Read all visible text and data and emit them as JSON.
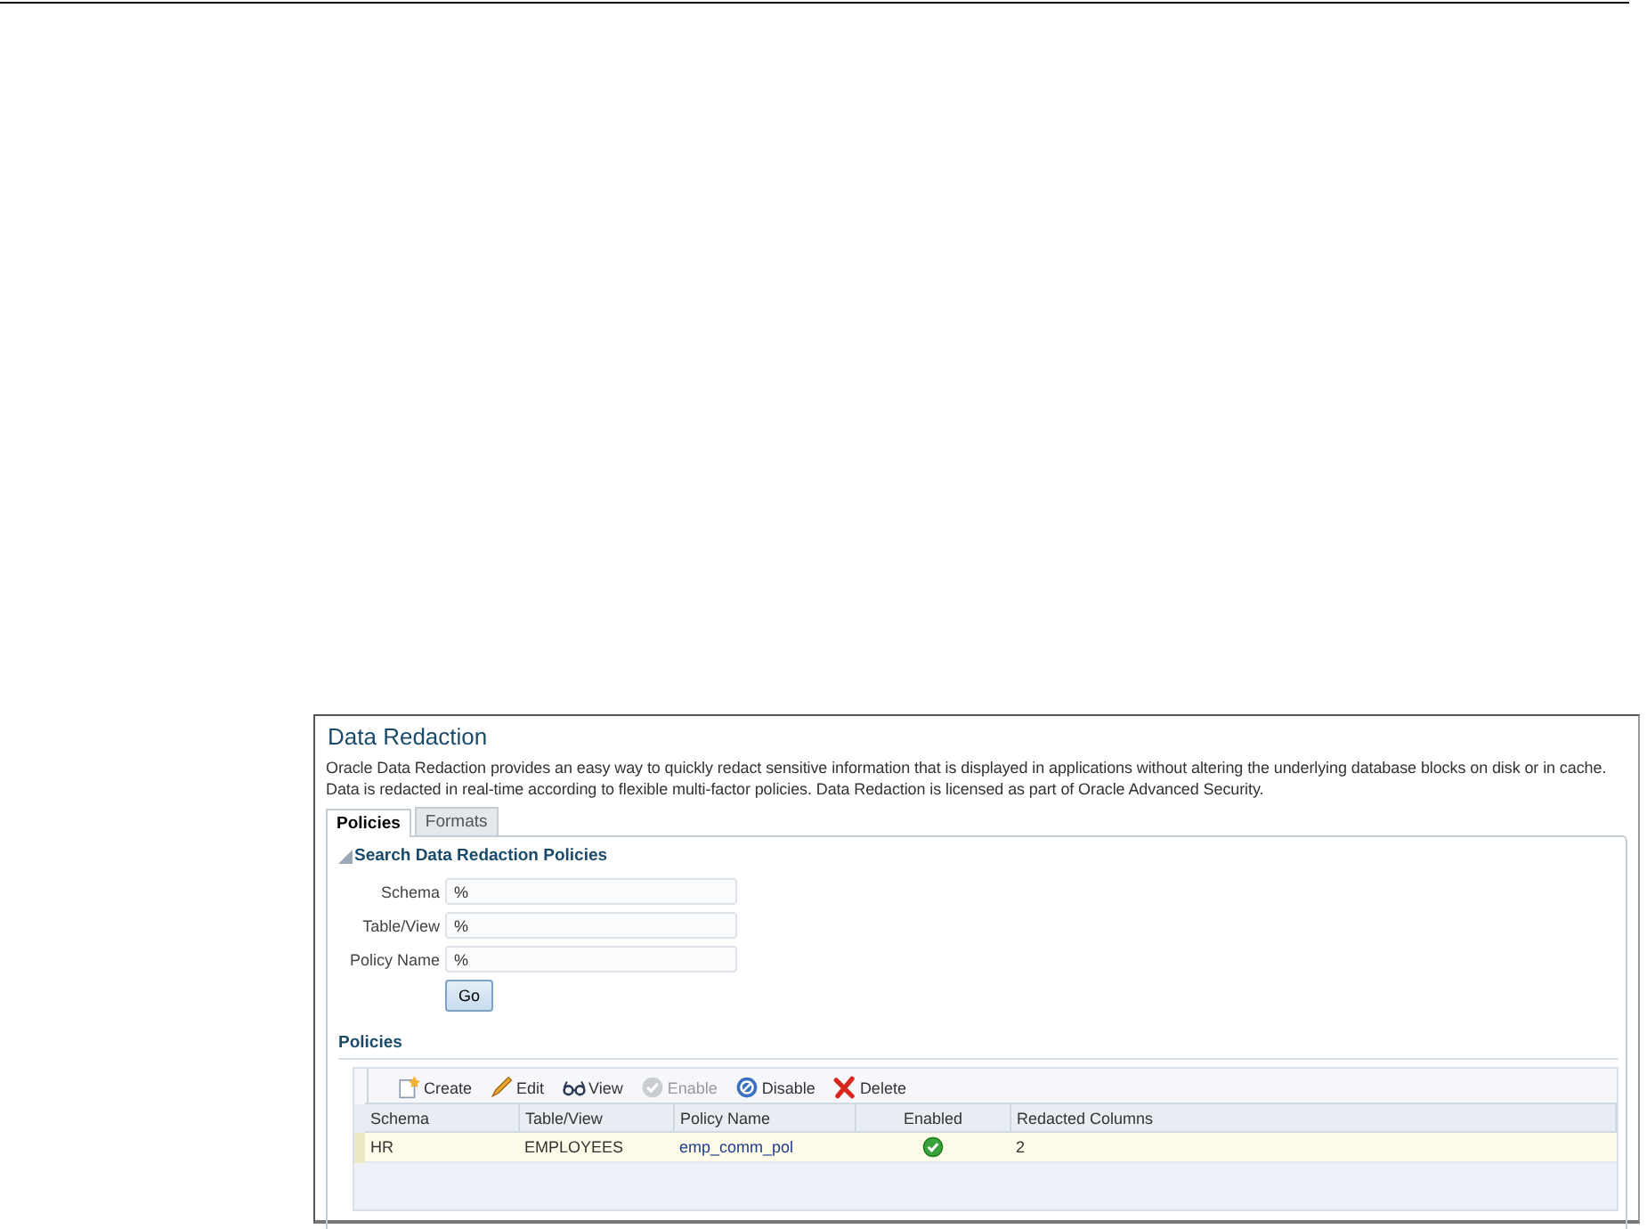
{
  "title": "Data Redaction",
  "description": [
    "Oracle Data Redaction provides an easy way to quickly redact sensitive information that is displayed in applications without altering the underlying database blocks on disk or in cache.",
    "Data is redacted in real-time according to flexible multi-factor policies. Data Redaction is licensed as part of Oracle Advanced Security."
  ],
  "tabs": [
    {
      "label": "Policies",
      "selected": true
    },
    {
      "label": "Formats",
      "selected": false
    }
  ],
  "search": {
    "title": "Search Data Redaction Policies",
    "expanded": true,
    "fields": [
      {
        "label": "Schema",
        "value": "%"
      },
      {
        "label": "Table/View",
        "value": "%"
      },
      {
        "label": "Policy Name",
        "value": "%"
      }
    ],
    "button": "Go"
  },
  "policies": {
    "title": "Policies",
    "toolbar": [
      {
        "kind": "create",
        "label": "Create",
        "disabled": false
      },
      {
        "kind": "edit",
        "label": "Edit",
        "disabled": false
      },
      {
        "kind": "view",
        "label": "View",
        "disabled": false
      },
      {
        "kind": "enable",
        "label": "Enable",
        "disabled": true
      },
      {
        "kind": "disable",
        "label": "Disable",
        "disabled": false
      },
      {
        "kind": "delete",
        "label": "Delete",
        "disabled": false
      }
    ],
    "columns": [
      "Schema",
      "Table/View",
      "Policy Name",
      "Enabled",
      "Redacted Columns"
    ],
    "rows": [
      {
        "schema": "HR",
        "table": "EMPLOYEES",
        "policy": "emp_comm_pol",
        "enabled": true,
        "redacted": "2",
        "selected": true
      }
    ]
  }
}
